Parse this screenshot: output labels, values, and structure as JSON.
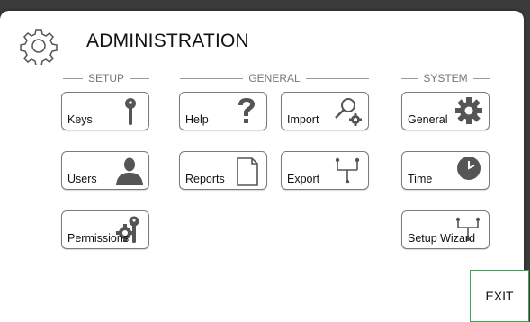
{
  "header": {
    "title": "ADMINISTRATION",
    "icon": "gear-outline-icon"
  },
  "sections": {
    "setup": "SETUP",
    "general": "GENERAL",
    "system": "SYSTEM"
  },
  "tiles": {
    "keys": {
      "label": "Keys",
      "icon": "key-icon"
    },
    "users": {
      "label": "Users",
      "icon": "user-icon"
    },
    "permissions": {
      "label": "Permissions",
      "icon": "gear-key-icon"
    },
    "help": {
      "label": "Help",
      "icon": "question-mark-icon"
    },
    "reports": {
      "label": "Reports",
      "icon": "document-icon"
    },
    "import": {
      "label": "Import",
      "icon": "search-gear-icon"
    },
    "export": {
      "label": "Export",
      "icon": "branch-icon"
    },
    "general": {
      "label": "General",
      "icon": "gear-icon"
    },
    "time": {
      "label": "Time",
      "icon": "clock-icon"
    },
    "setup_wizard": {
      "label": "Setup Wizard",
      "icon": "branch-icon"
    }
  },
  "exit": {
    "label": "EXIT"
  },
  "colors": {
    "exit_border": "#38a84a",
    "icon_gray": "#555555"
  }
}
